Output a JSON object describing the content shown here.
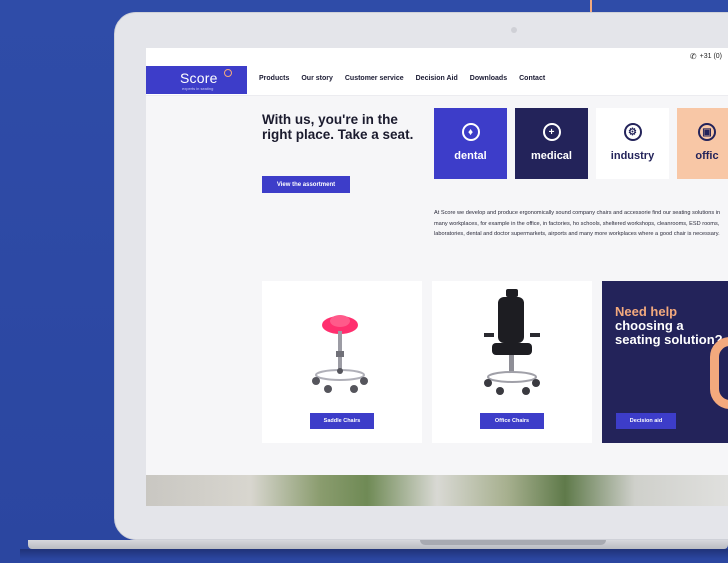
{
  "header": {
    "phone": "+31 (0)"
  },
  "logo": {
    "name": "Score",
    "tagline": "experts in seating"
  },
  "nav": {
    "items": [
      "Products",
      "Our story",
      "Customer service",
      "Decision Aid",
      "Downloads",
      "Contact"
    ]
  },
  "hero": {
    "title": "With us, you're in the right place. Take a seat.",
    "button": "View the assortment"
  },
  "tiles": [
    {
      "label": "dental",
      "icon": "dental-icon",
      "bg": "#3d3dc9",
      "fg": "#ffffff"
    },
    {
      "label": "medical",
      "icon": "medical-cross-icon",
      "bg": "#23235a",
      "fg": "#ffffff"
    },
    {
      "label": "industry",
      "icon": "gear-icon",
      "bg": "#ffffff",
      "fg": "#23235a"
    },
    {
      "label": "offic",
      "icon": "briefcase-icon",
      "bg": "#f8c7a6",
      "fg": "#23235a"
    }
  ],
  "about": {
    "text": "At Score we develop and produce ergonomically sound company chairs and accessorie find our seating solutions in many workplaces, for example in the office, in factories, ho schools, sheltered workshops, cleanrooms, ESD rooms, laboratories, dental and doctor supermarkets, airports and many more workplaces where a good chair is necessary."
  },
  "cards": [
    {
      "button": "Saddle Chairs",
      "image": "saddle-chair-image"
    },
    {
      "button": "Office Chairs",
      "image": "office-chair-image"
    }
  ],
  "help": {
    "title_line1": "Need help",
    "title_rest": "choosing a seating solution?",
    "button": "Decision aid"
  },
  "colors": {
    "brand": "#3d3dc9",
    "navy": "#23235a",
    "accent": "#f3a97d",
    "background": "#2e4aa3"
  }
}
